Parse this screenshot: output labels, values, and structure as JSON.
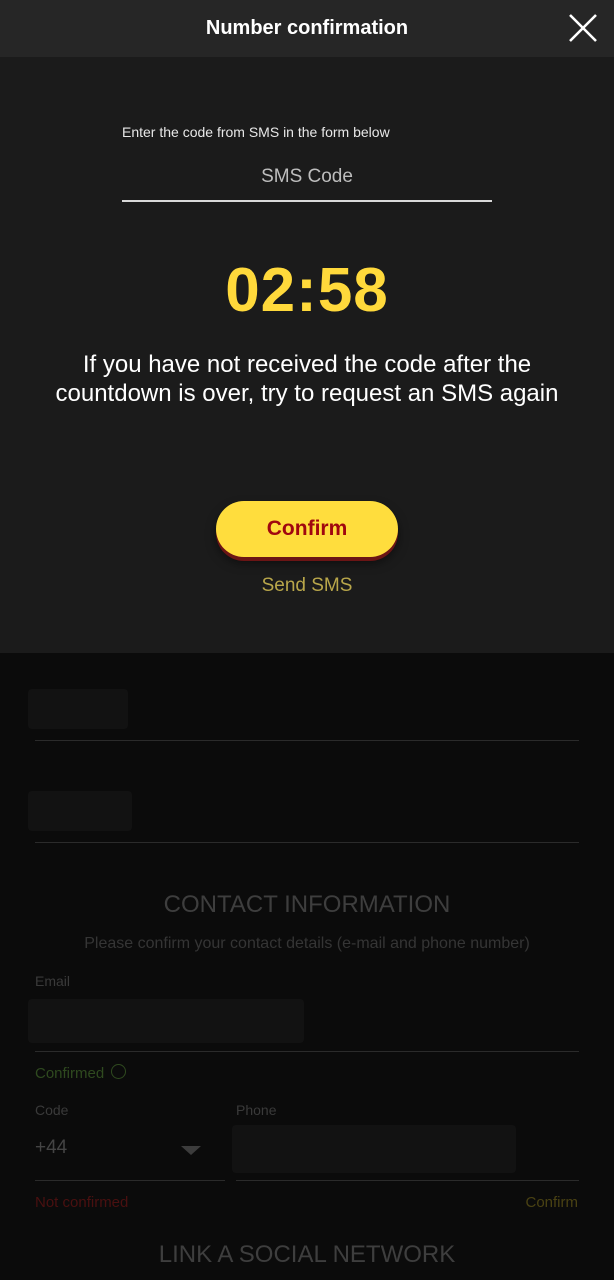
{
  "modal": {
    "title": "Number confirmation",
    "instruction": "Enter the code from SMS in the form below",
    "sms_placeholder": "SMS Code",
    "countdown": "02:58",
    "notice": "If you have not received the code after the countdown is over, try to request an SMS again",
    "confirm_label": "Confirm",
    "send_sms_label": "Send SMS"
  },
  "background": {
    "contact_title": "CONTACT INFORMATION",
    "contact_subtitle": "Please confirm your contact details (e-mail and phone number)",
    "email_label": "Email",
    "email_status": "Confirmed",
    "code_label": "Code",
    "code_value": "+44",
    "phone_label": "Phone",
    "phone_status": "Not confirmed",
    "phone_confirm_label": "Confirm",
    "social_title": "LINK A SOCIAL NETWORK"
  },
  "colors": {
    "accent": "#ffdd3d",
    "countdown": "#ffd93b",
    "confirm_text": "#a0070f",
    "link": "#b8a64a"
  }
}
